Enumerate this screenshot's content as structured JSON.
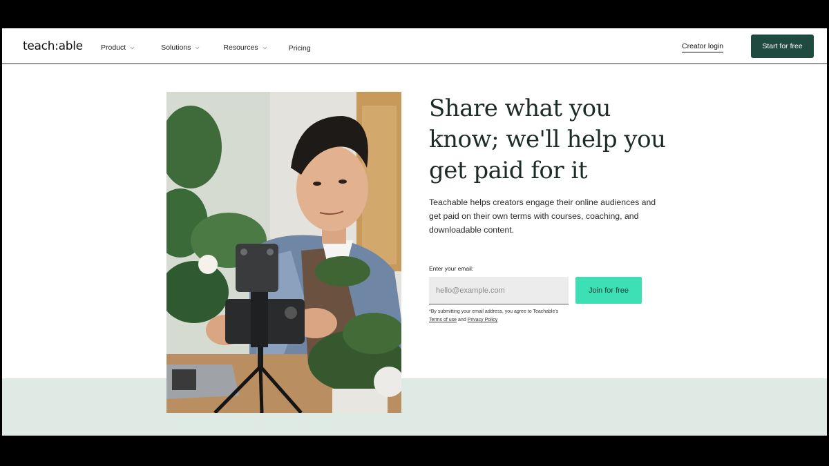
{
  "brand": {
    "logo_text": "teach:able"
  },
  "nav": {
    "menu": [
      {
        "label": "Product",
        "has_dropdown": true
      },
      {
        "label": "Solutions",
        "has_dropdown": true
      },
      {
        "label": "Resources",
        "has_dropdown": true
      },
      {
        "label": "Pricing",
        "has_dropdown": false
      }
    ],
    "login_label": "Creator login",
    "cta_label": "Start for free"
  },
  "hero": {
    "headline": "Share what you know; we'll help you get paid for it",
    "subheadline": "Teachable helps creators engage their online audiences and get paid on their own terms with courses, coaching, and downloadable content.",
    "email_label": "Enter your email:",
    "email_placeholder": "hello@example.com",
    "email_value": "",
    "join_label": "Join for free",
    "disclaimer": {
      "prefix": "*By submitting your email address, you agree to Teachable's",
      "terms_link": "Terms of use",
      "and": "and",
      "privacy_link": "Privacy Policy"
    },
    "image_subject": "Creator filming plants with a phone camera on a tripod"
  },
  "colors": {
    "brand_dark_green": "#1f4a3f",
    "accent_mint": "#3de0b4",
    "band_bg": "#dfeae4",
    "text_dark": "#1d2b25"
  },
  "icons": {
    "dropdown": "chevron-down-icon"
  }
}
